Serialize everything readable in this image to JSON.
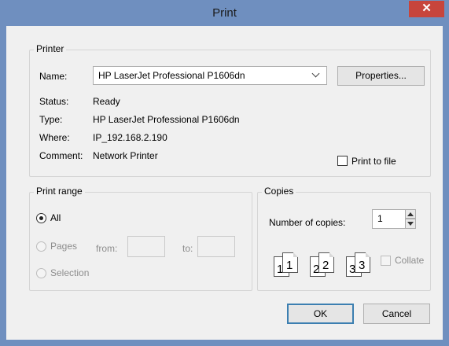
{
  "window": {
    "title": "Print",
    "close_glyph": "✕"
  },
  "printer_group": {
    "legend": "Printer",
    "name_label": "Name:",
    "name_value": "HP LaserJet Professional P1606dn",
    "properties_button": "Properties...",
    "status_label": "Status:",
    "status_value": "Ready",
    "type_label": "Type:",
    "type_value": "HP LaserJet Professional P1606dn",
    "where_label": "Where:",
    "where_value": "IP_192.168.2.190",
    "comment_label": "Comment:",
    "comment_value": "Network Printer",
    "print_to_file_label": "Print to file",
    "print_to_file_checked": false
  },
  "print_range_group": {
    "legend": "Print range",
    "all_label": "All",
    "pages_label": "Pages",
    "from_label": "from:",
    "to_label": "to:",
    "from_value": "",
    "to_value": "",
    "selection_label": "Selection",
    "selected": "All"
  },
  "copies_group": {
    "legend": "Copies",
    "number_label": "Number of copies:",
    "number_value": "1",
    "collate_label": "Collate",
    "collate_checked": false,
    "collate_pages": [
      "1",
      "1",
      "2",
      "2",
      "3",
      "3"
    ]
  },
  "buttons": {
    "ok": "OK",
    "cancel": "Cancel"
  },
  "colors": {
    "titlebar": "#6f8fbf",
    "close": "#c7453c",
    "dialog_bg": "#f0f0f0",
    "default_button_border": "#3c7fb1"
  }
}
